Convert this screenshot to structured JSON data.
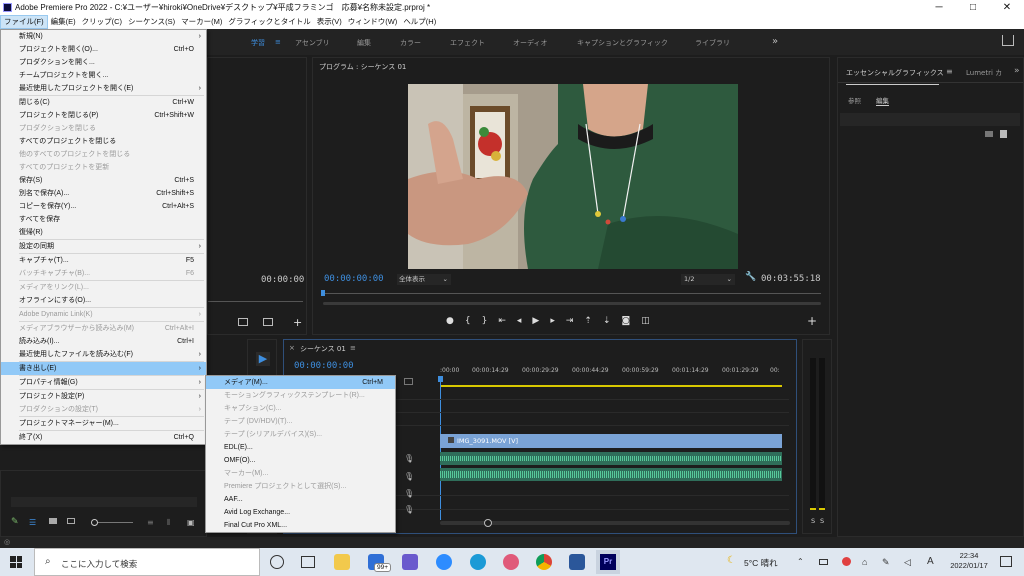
{
  "window": {
    "title": "Adobe Premiere Pro 2022 - C:¥ユーザー¥hiroki¥OneDrive¥デスクトップ¥平成フラミンゴ　応募¥名称未設定.prproj *",
    "minimize": "─",
    "maximize": "□",
    "close": "✕"
  },
  "menubar": [
    "ファイル(F)",
    "編集(E)",
    "クリップ(C)",
    "シーケンス(S)",
    "マーカー(M)",
    "グラフィックとタイトル",
    "表示(V)",
    "ウィンドウ(W)",
    "ヘルプ(H)"
  ],
  "workspaces": [
    "学習",
    "アセンブリ",
    "編集",
    "カラー",
    "エフェクト",
    "オーディオ",
    "キャプションとグラフィック",
    "ライブラリ"
  ],
  "workspace_overflow": "»",
  "file_menu": [
    {
      "label": "新規(N)",
      "shortcut": "",
      "submenu": true,
      "disabled": false
    },
    {
      "label": "プロジェクトを開く(O)...",
      "shortcut": "Ctrl+O",
      "submenu": false,
      "disabled": false
    },
    {
      "label": "プロダクションを開く...",
      "shortcut": "",
      "submenu": false,
      "disabled": false
    },
    {
      "label": "チームプロジェクトを開く...",
      "shortcut": "",
      "submenu": false,
      "disabled": false
    },
    {
      "label": "最近使用したプロジェクトを開く(E)",
      "shortcut": "",
      "submenu": true,
      "disabled": false
    },
    {
      "sep": true
    },
    {
      "label": "閉じる(C)",
      "shortcut": "Ctrl+W",
      "submenu": false,
      "disabled": false
    },
    {
      "label": "プロジェクトを閉じる(P)",
      "shortcut": "Ctrl+Shift+W",
      "submenu": false,
      "disabled": false
    },
    {
      "label": "プロダクションを閉じる",
      "shortcut": "",
      "submenu": false,
      "disabled": true
    },
    {
      "label": "すべてのプロジェクトを閉じる",
      "shortcut": "",
      "submenu": false,
      "disabled": false
    },
    {
      "label": "他のすべてのプロジェクトを閉じる",
      "shortcut": "",
      "submenu": false,
      "disabled": true
    },
    {
      "label": "すべてのプロジェクトを更新",
      "shortcut": "",
      "submenu": false,
      "disabled": true
    },
    {
      "label": "保存(S)",
      "shortcut": "Ctrl+S",
      "submenu": false,
      "disabled": false
    },
    {
      "label": "別名で保存(A)...",
      "shortcut": "Ctrl+Shift+S",
      "submenu": false,
      "disabled": false
    },
    {
      "label": "コピーを保存(Y)...",
      "shortcut": "Ctrl+Alt+S",
      "submenu": false,
      "disabled": false
    },
    {
      "label": "すべてを保存",
      "shortcut": "",
      "submenu": false,
      "disabled": false
    },
    {
      "label": "復帰(R)",
      "shortcut": "",
      "submenu": false,
      "disabled": false
    },
    {
      "sep": true
    },
    {
      "label": "設定の同期",
      "shortcut": "",
      "submenu": true,
      "disabled": false
    },
    {
      "sep": true
    },
    {
      "label": "キャプチャ(T)...",
      "shortcut": "F5",
      "submenu": false,
      "disabled": false
    },
    {
      "label": "バッチキャプチャ(B)...",
      "shortcut": "F6",
      "submenu": false,
      "disabled": true
    },
    {
      "sep": true
    },
    {
      "label": "メディアをリンク(L)...",
      "shortcut": "",
      "submenu": false,
      "disabled": true
    },
    {
      "label": "オフラインにする(O)...",
      "shortcut": "",
      "submenu": false,
      "disabled": false
    },
    {
      "sep": true
    },
    {
      "label": "Adobe Dynamic Link(K)",
      "shortcut": "",
      "submenu": true,
      "disabled": true
    },
    {
      "sep": true
    },
    {
      "label": "メディアブラウザーから読み込み(M)",
      "shortcut": "Ctrl+Alt+I",
      "submenu": false,
      "disabled": true
    },
    {
      "label": "読み込み(I)...",
      "shortcut": "Ctrl+I",
      "submenu": false,
      "disabled": false
    },
    {
      "label": "最近使用したファイルを読み込む(F)",
      "shortcut": "",
      "submenu": true,
      "disabled": false
    },
    {
      "sep": true
    },
    {
      "label": "書き出し(E)",
      "shortcut": "",
      "submenu": true,
      "disabled": false,
      "highlight": true
    },
    {
      "sep": true
    },
    {
      "label": "プロパティ情報(G)",
      "shortcut": "",
      "submenu": true,
      "disabled": false
    },
    {
      "sep": true
    },
    {
      "label": "プロジェクト設定(P)",
      "shortcut": "",
      "submenu": true,
      "disabled": false
    },
    {
      "label": "プロダクションの設定(T)",
      "shortcut": "",
      "submenu": true,
      "disabled": true
    },
    {
      "sep": true
    },
    {
      "label": "プロジェクトマネージャー(M)...",
      "shortcut": "",
      "submenu": false,
      "disabled": false
    },
    {
      "sep": true
    },
    {
      "label": "終了(X)",
      "shortcut": "Ctrl+Q",
      "submenu": false,
      "disabled": false
    }
  ],
  "export_menu": [
    {
      "label": "メディア(M)...",
      "shortcut": "Ctrl+M",
      "disabled": false,
      "highlight": true
    },
    {
      "label": "モーショングラフィックステンプレート(R)...",
      "shortcut": "",
      "disabled": true
    },
    {
      "label": "キャプション(C)...",
      "shortcut": "",
      "disabled": true
    },
    {
      "label": "テープ (DV/HDV)(T)...",
      "shortcut": "",
      "disabled": true
    },
    {
      "label": "テープ (シリアルデバイス)(S)...",
      "shortcut": "",
      "disabled": true
    },
    {
      "label": "EDL(E)...",
      "shortcut": "",
      "disabled": false
    },
    {
      "label": "OMF(O)...",
      "shortcut": "",
      "disabled": false
    },
    {
      "label": "マーカー(M)...",
      "shortcut": "",
      "disabled": true
    },
    {
      "label": "Premiere プロジェクトとして選択(S)...",
      "shortcut": "",
      "disabled": true
    },
    {
      "label": "AAF...",
      "shortcut": "",
      "disabled": false
    },
    {
      "label": "Avid Log Exchange...",
      "shortcut": "",
      "disabled": false
    },
    {
      "label": "Final Cut Pro XML...",
      "shortcut": "",
      "disabled": false
    }
  ],
  "source_panel": {
    "timecode": "00:00:00"
  },
  "program": {
    "title": "プログラム : シーケンス 01",
    "timecode_in": "00:00:00:00",
    "fit": "全体表示",
    "resolution": "1/2",
    "duration": "00:03:55:18"
  },
  "essential_graphics": {
    "tab": "エッセンシャルグラフィックス",
    "tab2": "Lumetri カ",
    "subtab_browse": "参照",
    "subtab_edit": "編集"
  },
  "timeline": {
    "title": "シーケンス 01",
    "timecode": "00:00:00:00",
    "ruler": [
      ":00:00",
      "00:00:14:29",
      "00:00:29:29",
      "00:00:44:29",
      "00:00:59:29",
      "00:01:14:29",
      "00:01:29:29",
      "00:"
    ],
    "clip_name": "IMG_3091.MOV [V]"
  },
  "meter": {
    "s1": "S",
    "s2": "S"
  },
  "taskbar": {
    "search_placeholder": "ここに入力して検索",
    "weather": "5°C  晴れ",
    "time": "22:34",
    "date": "2022/01/17",
    "ime": "A",
    "mail_badge": "99+",
    "pr_label": "Pr"
  },
  "colors": {
    "accent": "#3e8ede",
    "menu_highlight": "#91c9f7",
    "audio_wave": "#3fb07e",
    "clip_blue": "#7aa3d6"
  }
}
